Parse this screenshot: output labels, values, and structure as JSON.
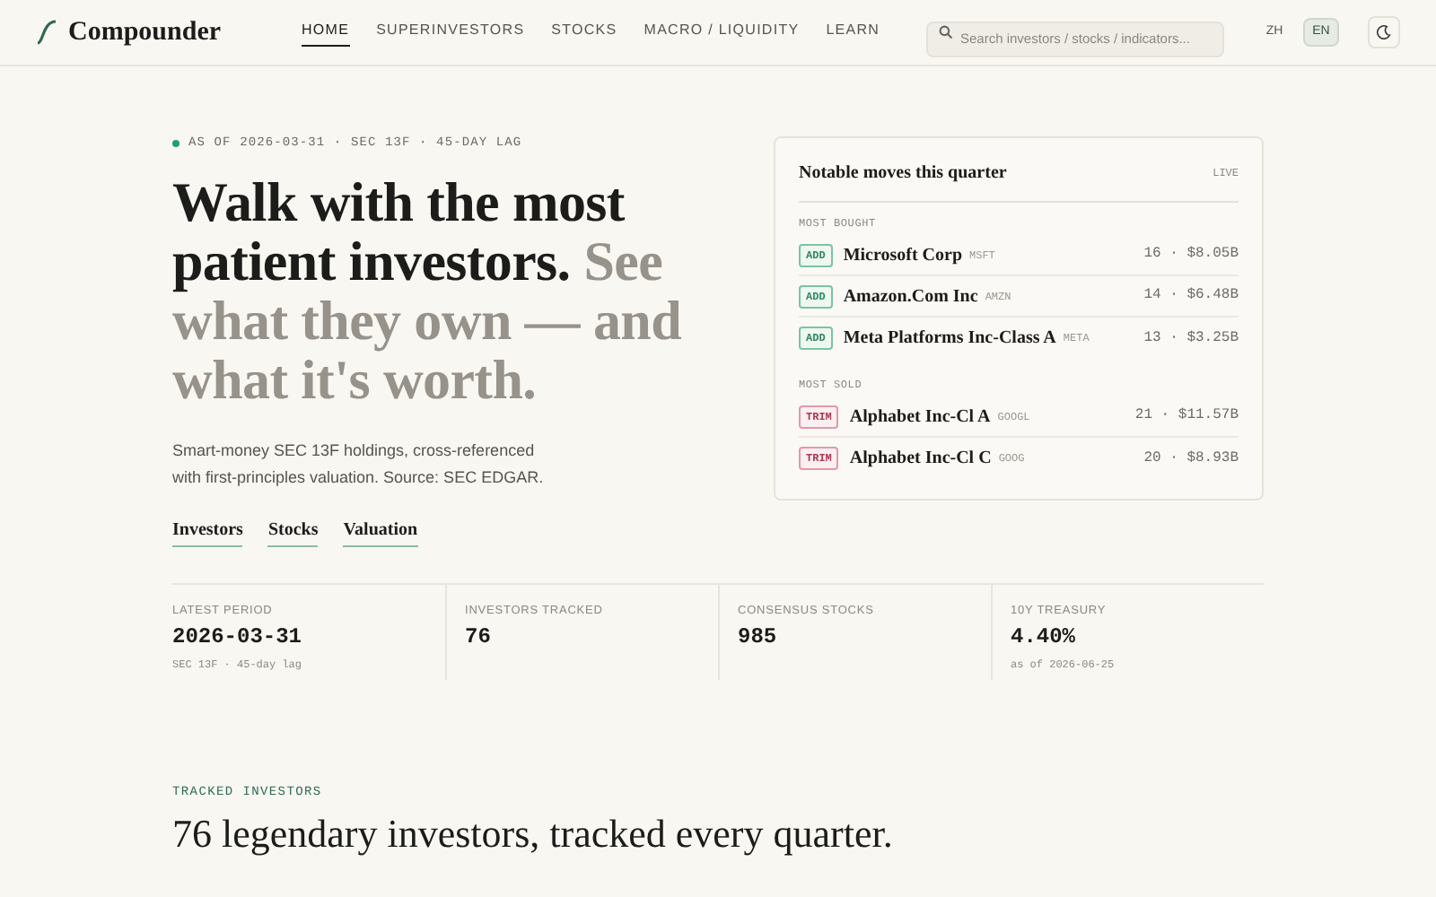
{
  "brand": "Compounder",
  "nav": [
    {
      "label": "HOME",
      "selected": true
    },
    {
      "label": "SUPERINVESTORS",
      "selected": false
    },
    {
      "label": "STOCKS",
      "selected": false
    },
    {
      "label": "MACRO / LIQUIDITY",
      "selected": false
    },
    {
      "label": "LEARN",
      "selected": false
    }
  ],
  "search": {
    "placeholder": "Search investors / stocks / indicators..."
  },
  "languages": [
    {
      "label": "ZH",
      "selected": false
    },
    {
      "label": "EN",
      "selected": true
    }
  ],
  "hero": {
    "eyebrow": "AS OF 2026-03-31 · SEC 13F · 45-DAY LAG",
    "title_lead": "Walk with the most patient investors.",
    "title_rest": "See what they own — and what it's worth.",
    "description": "Smart-money SEC 13F holdings, cross-referenced with first-principles valuation. Source: SEC EDGAR.",
    "links": [
      "Investors",
      "Stocks",
      "Valuation"
    ]
  },
  "moves": {
    "title": "Notable moves this quarter",
    "badge": "LIVE",
    "groups": [
      {
        "label": "MOST BOUGHT",
        "rows": [
          {
            "kind": "add",
            "tag": "ADD",
            "name": "Microsoft Corp",
            "ticker": "MSFT",
            "stat": "16 · $8.05B"
          },
          {
            "kind": "add",
            "tag": "ADD",
            "name": "Amazon.Com Inc",
            "ticker": "AMZN",
            "stat": "14 · $6.48B"
          },
          {
            "kind": "add",
            "tag": "ADD",
            "name": "Meta Platforms Inc-Class A",
            "ticker": "META",
            "stat": "13 · $3.25B"
          }
        ]
      },
      {
        "label": "MOST SOLD",
        "rows": [
          {
            "kind": "trim",
            "tag": "TRIM",
            "name": "Alphabet Inc-Cl A",
            "ticker": "GOOGL",
            "stat": "21 · $11.57B"
          },
          {
            "kind": "trim",
            "tag": "TRIM",
            "name": "Alphabet Inc-Cl C",
            "ticker": "GOOG",
            "stat": "20 · $8.93B"
          }
        ]
      }
    ]
  },
  "stats": [
    {
      "label": "LATEST PERIOD",
      "value": "2026-03-31",
      "note": "SEC 13F · 45-day lag"
    },
    {
      "label": "INVESTORS TRACKED",
      "value": "76"
    },
    {
      "label": "CONSENSUS STOCKS",
      "value": "985"
    },
    {
      "label": "10Y TREASURY",
      "value": "4.40%",
      "note": "as of 2026-06-25"
    }
  ],
  "section": {
    "eyebrow": "TRACKED INVESTORS",
    "title": "76 legendary investors, tracked every quarter."
  }
}
